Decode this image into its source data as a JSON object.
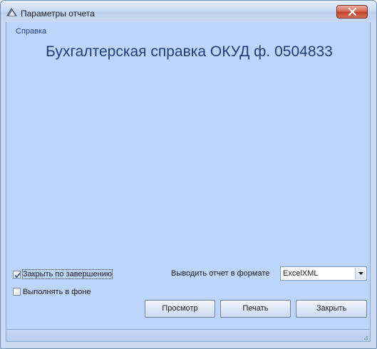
{
  "window": {
    "title": "Параметры отчета",
    "icon": "report-icon",
    "close_icon": "close-icon"
  },
  "help_link": "Справка",
  "report_title": "Бухгалтерская справка ОКУД ф. 0504833",
  "options": {
    "close_on_finish": {
      "label": "Закрыть по завершению",
      "checked": true
    },
    "run_in_background": {
      "label": "Выполнять в фоне",
      "checked": false
    }
  },
  "output_format": {
    "label": "Выводить отчет в формате",
    "value": "ExcelXML"
  },
  "buttons": {
    "preview": "Просмотр",
    "print": "Печать",
    "close": "Закрыть"
  },
  "colors": {
    "background": "#bdd5fb",
    "title": "#1f3d7a",
    "link": "#1f3f8f",
    "close_button": "#c0402a"
  }
}
